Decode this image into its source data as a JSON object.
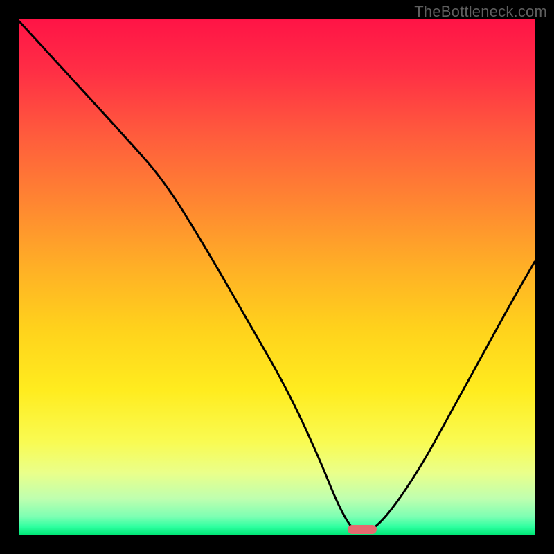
{
  "watermark": "TheBottleneck.com",
  "marker": {
    "color": "#e46a6f"
  },
  "chart_data": {
    "type": "line",
    "title": "",
    "xlabel": "",
    "ylabel": "",
    "xlim": [
      0,
      100
    ],
    "ylim": [
      0,
      100
    ],
    "x": [
      0,
      10,
      20,
      28,
      36,
      44,
      52,
      58,
      62,
      65,
      68,
      72,
      78,
      84,
      90,
      96,
      100
    ],
    "values": [
      100,
      89,
      78,
      69,
      56,
      42,
      28,
      15,
      5,
      0,
      0,
      4,
      13,
      24,
      35,
      46,
      53
    ],
    "flat_segment_x": [
      62,
      70
    ],
    "marker_x": 66.5,
    "annotations": []
  },
  "gradient_stops": [
    {
      "offset": 0.0,
      "color": "#ff1446"
    },
    {
      "offset": 0.1,
      "color": "#ff2e45"
    },
    {
      "offset": 0.22,
      "color": "#ff5a3d"
    },
    {
      "offset": 0.35,
      "color": "#ff8432"
    },
    {
      "offset": 0.48,
      "color": "#ffaf26"
    },
    {
      "offset": 0.6,
      "color": "#ffd21c"
    },
    {
      "offset": 0.72,
      "color": "#ffec1f"
    },
    {
      "offset": 0.82,
      "color": "#f9fb52"
    },
    {
      "offset": 0.88,
      "color": "#eaff8a"
    },
    {
      "offset": 0.93,
      "color": "#bfffaf"
    },
    {
      "offset": 0.965,
      "color": "#7dffb3"
    },
    {
      "offset": 0.985,
      "color": "#2effa0"
    },
    {
      "offset": 1.0,
      "color": "#00e676"
    }
  ]
}
